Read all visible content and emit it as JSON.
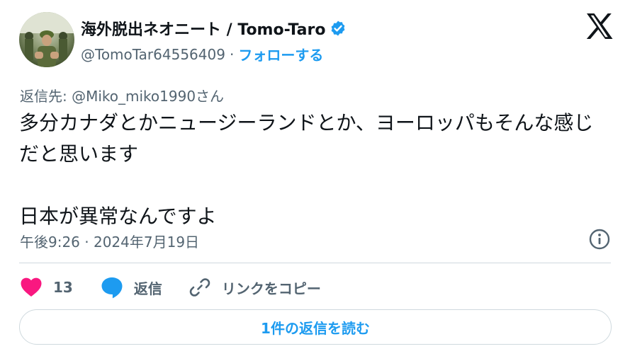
{
  "author": {
    "display_name": "海外脱出ネオニート / Tomo-Taro",
    "handle": "@TomoTar64556409",
    "separator": "·",
    "follow_label": "フォローする"
  },
  "reply_to": "返信先: @Miko_miko1990さん",
  "tweet": {
    "text": "多分カナダとかニュージーランドとか、ヨーロッパもそんな感じだと思います\n\n日本が異常なんですよ"
  },
  "timestamp": "午後9:26 · 2024年7月19日",
  "actions": {
    "like_count": "13",
    "reply_label": "返信",
    "copy_link_label": "リンクをコピー"
  },
  "read_replies_label": "1件の返信を読む",
  "icons": {
    "verified": "verified-badge-icon",
    "logo": "x-logo-icon",
    "info": "info-icon",
    "like": "heart-icon",
    "reply": "speech-bubble-icon",
    "link": "link-icon"
  },
  "colors": {
    "accent": "#1d9bf0",
    "like": "#f91880",
    "text": "#0f1419",
    "secondary": "#536471",
    "border": "#cfd9de"
  }
}
